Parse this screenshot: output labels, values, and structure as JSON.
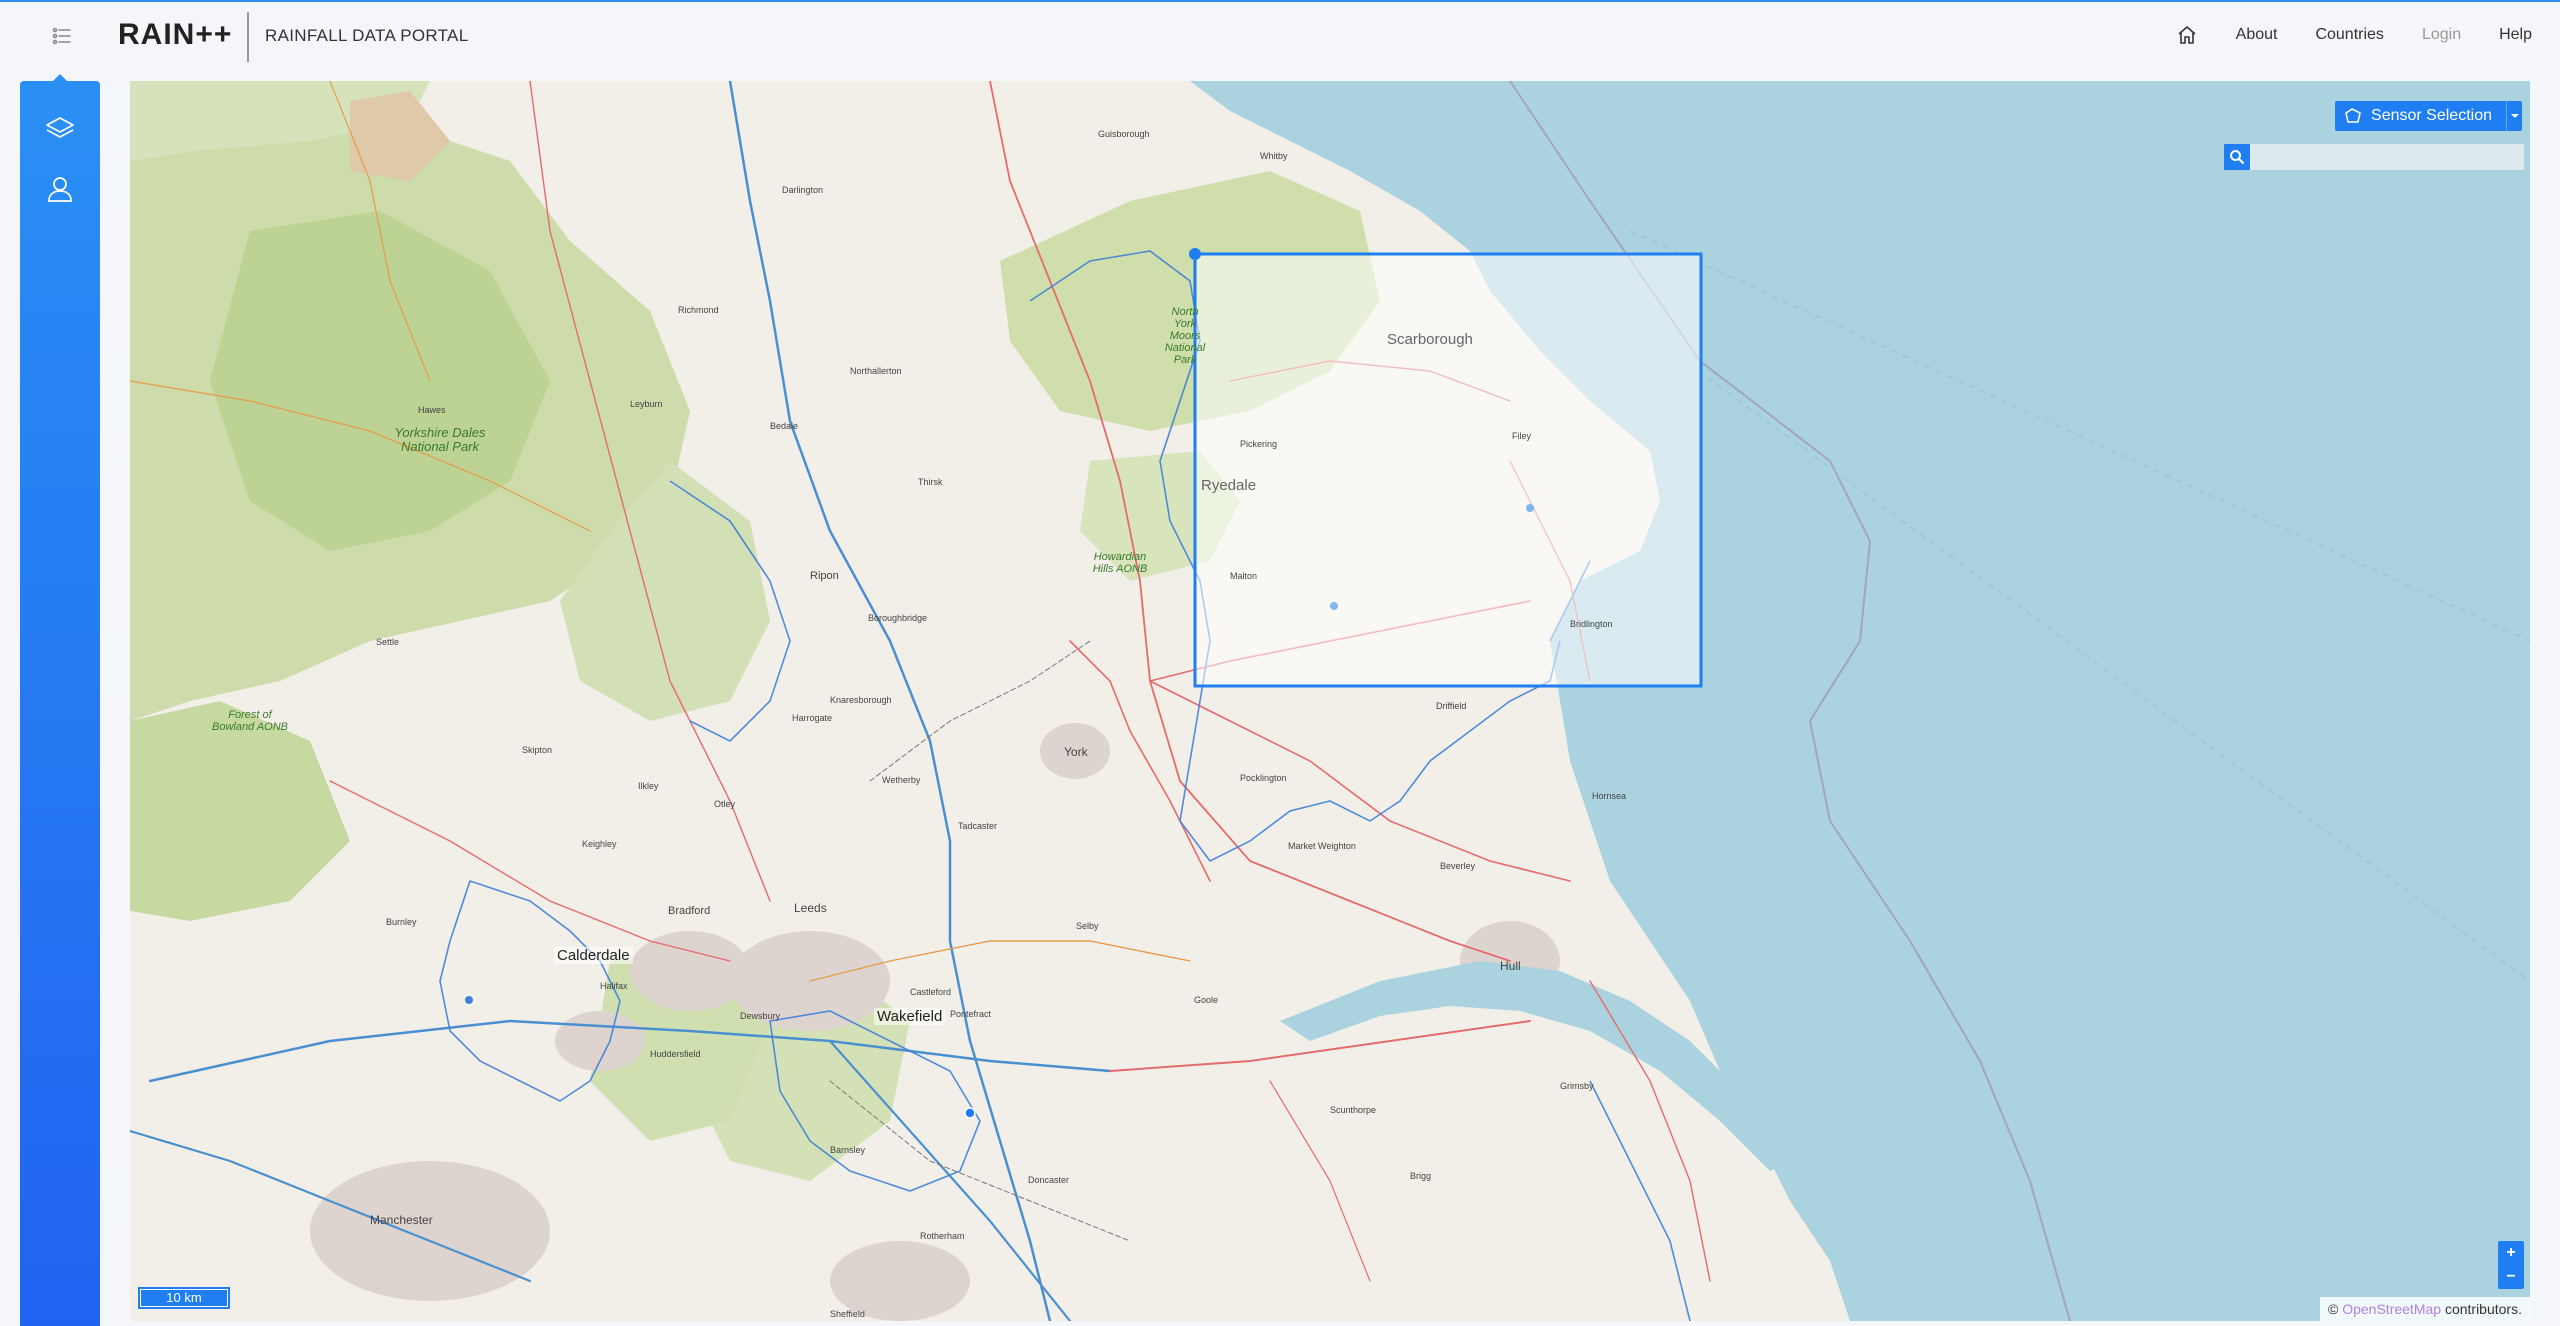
{
  "header": {
    "logo_text": "RAIN++",
    "title": "RAINFALL DATA PORTAL",
    "nav": {
      "about": "About",
      "countries": "Countries",
      "login": "Login",
      "help": "Help"
    }
  },
  "map": {
    "sensor_selection_label": "Sensor Selection",
    "search_placeholder": "",
    "zoom_in": "+",
    "zoom_out": "−",
    "scale_label": "10 km",
    "attribution_prefix": "© ",
    "attribution_link": "OpenStreetMap",
    "attribution_suffix": " contributors.",
    "regions": {
      "scarborough": "Scarborough",
      "ryedale": "Ryedale",
      "calderdale": "Calderdale",
      "wakefield": "Wakefield"
    },
    "parks": {
      "yorkshire_dales": "Yorkshire Dales National Park",
      "bowland": "Forest of Bowland AONB",
      "moors": "North York Moors National Park",
      "howardian": "Howardian Hills AONB"
    },
    "places": {
      "york": "York",
      "leeds": "Leeds",
      "bradford": "Bradford",
      "hull": "Hull",
      "ripon": "Ripon",
      "harrogate": "Harrogate",
      "manchester": "Manchester",
      "doncaster": "Doncaster",
      "sheffield": "Sheffield",
      "richmond": "Richmond",
      "darlington": "Darlington",
      "thirsk": "Thirsk",
      "selby": "Selby",
      "goole": "Goole",
      "beverley": "Beverley",
      "driffield": "Driffield",
      "hornsea": "Hornsea",
      "pocklington": "Pocklington",
      "skipton": "Skipton",
      "halifax": "Halifax",
      "huddersfield": "Huddersfield",
      "barnsley": "Barnsley",
      "rotherham": "Rotherham",
      "whitby": "Whitby",
      "filey": "Filey",
      "bridlington": "Bridlington",
      "malton": "Malton",
      "pickering": "Pickering",
      "northallerton": "Northallerton",
      "scunthorpe": "Scunthorpe",
      "grimsby": "Grimsby",
      "market_weighton": "Market Weighton",
      "tadcaster": "Tadcaster",
      "wetherby": "Wetherby",
      "knaresborough": "Knaresborough",
      "boroughbridge": "Boroughbridge",
      "bedale": "Bedale",
      "leyburn": "Leyburn",
      "settle": "Settle",
      "hawes": "Hawes",
      "burnley": "Burnley",
      "keighley": "Keighley",
      "ilkley": "Ilkley",
      "otley": "Otley",
      "pontefract": "Pontefract",
      "castleford": "Castleford",
      "dewsbury": "Dewsbury",
      "wakefield_town": "Wakefield",
      "guisborough": "Guisborough",
      "brigg": "Brigg"
    }
  },
  "colors": {
    "accent": "#1e7ef2",
    "sea": "#aad3df",
    "land": "#f2efe9",
    "park": "#c8dca0"
  },
  "icons": {
    "menu": "list-icon",
    "home": "home-icon",
    "layers": "layers-icon",
    "user": "user-icon",
    "sensor": "polygon-draw-icon",
    "search": "search-icon"
  }
}
